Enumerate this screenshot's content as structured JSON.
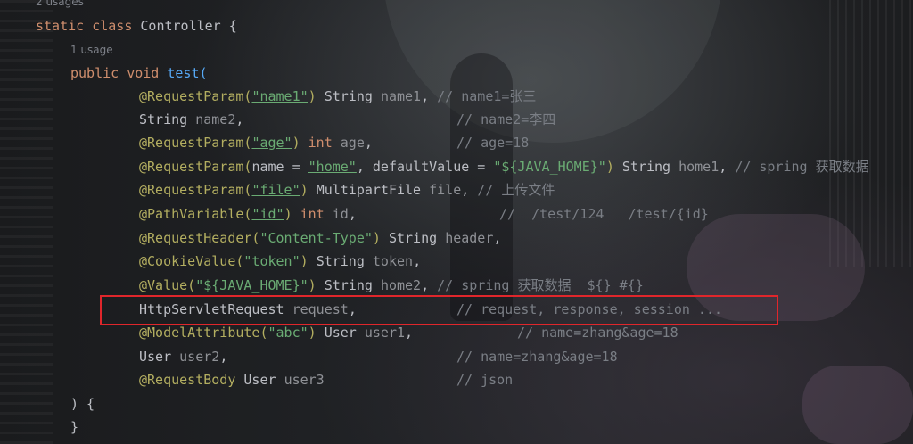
{
  "hints": {
    "class_usages": "2 usages",
    "method_usages": "1 usage"
  },
  "code": {
    "class_decl": {
      "kw": "static class",
      "name": "Controller",
      "brace": "{"
    },
    "method_decl": {
      "kw": "public void",
      "name": "test("
    },
    "params": [
      {
        "ann": "@RequestParam(",
        "str": "\"name1\"",
        "close": ")",
        "type": "String",
        "name": "name1",
        "sep": ",",
        "comment": "// name1=张三"
      },
      {
        "type": "String",
        "name": "name2",
        "sep": ",",
        "comment": "// name2=李四"
      },
      {
        "ann": "@RequestParam(",
        "str": "\"age\"",
        "close": ")",
        "type": "int",
        "name": "age",
        "sep": ",",
        "comment": "// age=18"
      },
      {
        "ann": "@RequestParam(",
        "attr1": "name = ",
        "str": "\"home\"",
        "attr2": ", defaultValue = ",
        "str2": "\"${JAVA_HOME}\"",
        "close": ")",
        "type": "String",
        "name": "home1",
        "sep": ",",
        "comment": "// spring 获取数据"
      },
      {
        "ann": "@RequestParam(",
        "str": "\"file\"",
        "close": ")",
        "type": "MultipartFile",
        "name": "file",
        "sep": ",",
        "comment": "// 上传文件"
      },
      {
        "ann": "@PathVariable(",
        "str": "\"id\"",
        "close": ")",
        "type": "int",
        "name": "id",
        "sep": ",",
        "comment": "//  /test/124   /test/{id}"
      },
      {
        "ann": "@RequestHeader(",
        "str": "\"Content-Type\"",
        "close": ")",
        "type": "String",
        "name": "header",
        "sep": ","
      },
      {
        "ann": "@CookieValue(",
        "str": "\"token\"",
        "close": ")",
        "type": "String",
        "name": "token",
        "sep": ","
      },
      {
        "ann": "@Value(",
        "str": "\"${JAVA_HOME}\"",
        "close": ")",
        "type": "String",
        "name": "home2",
        "sep": ",",
        "comment": "// spring 获取数据  ${} #{}"
      },
      {
        "type": "HttpServletRequest",
        "name": "request",
        "sep": ",",
        "comment": "// request, response, session ..."
      },
      {
        "ann": "@ModelAttribute(",
        "str": "\"abc\"",
        "close": ")",
        "type": "User",
        "name": "user1",
        "sep": ",",
        "comment": "// name=zhang&age=18"
      },
      {
        "type": "User",
        "name": "user2",
        "sep": ",",
        "comment": "// name=zhang&age=18"
      },
      {
        "ann": "@RequestBody",
        "type": "User",
        "name": "user3",
        "comment": "// json"
      }
    ],
    "method_close": ") {",
    "body_close": "}"
  }
}
